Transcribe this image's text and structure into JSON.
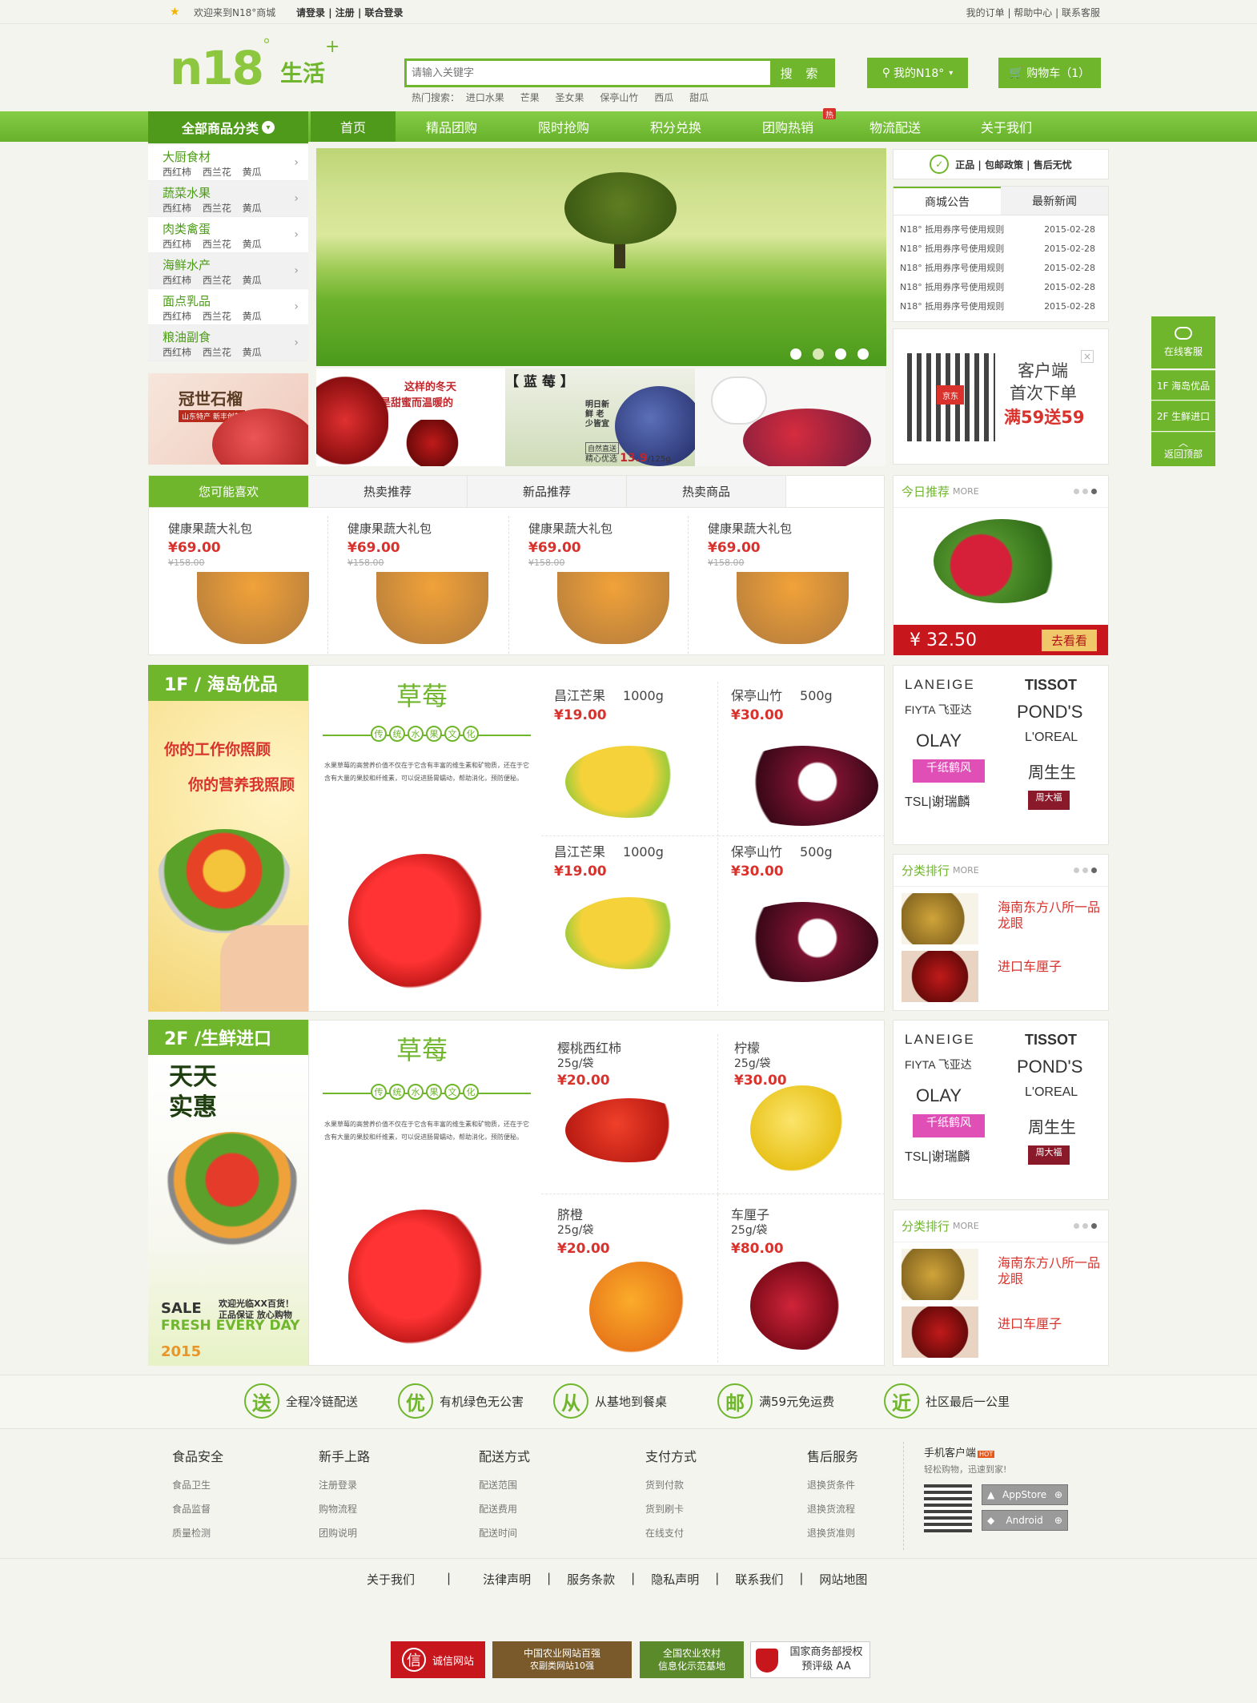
{
  "topbar": {
    "welcome": "欢迎来到N18°商城",
    "login": "请登录",
    "register": "注册",
    "union_login": "联合登录",
    "my_orders": "我的订单",
    "help": "帮助中心",
    "contact": "联系客服"
  },
  "logo": {
    "brand": "n18",
    "sup": "°",
    "life": "生活",
    "plus": "+"
  },
  "search": {
    "placeholder": "请输入关键字",
    "button": "搜 索",
    "hot_label": "热门搜索：",
    "hot": [
      "进口水果",
      "芒果",
      "圣女果",
      "保亭山竹",
      "西瓜",
      "甜瓜"
    ]
  },
  "header": {
    "my_n18": "我的N18°",
    "cart": "购物车（1）"
  },
  "nav": {
    "all_categories": "全部商品分类",
    "items": [
      "首页",
      "精品团购",
      "限时抢购",
      "积分兑换",
      "团购热销",
      "物流配送",
      "关于我们"
    ],
    "hot_badge": "热"
  },
  "categories": [
    {
      "title": "大厨食材",
      "subs": "西红柿 西兰花 黄瓜"
    },
    {
      "title": "蔬菜水果",
      "subs": "西红柿 西兰花 黄瓜"
    },
    {
      "title": "肉类禽蛋",
      "subs": "西红柿 西兰花 黄瓜"
    },
    {
      "title": "海鲜水产",
      "subs": "西红柿 西兰花 黄瓜"
    },
    {
      "title": "面点乳品",
      "subs": "西红柿 西兰花 黄瓜"
    },
    {
      "title": "粮油副食",
      "subs": "西红柿 西兰花 黄瓜"
    }
  ],
  "promo_ad": {
    "title": "冠世石榴",
    "sub": "山东特产  新丰创新"
  },
  "sub_banners": [
    {
      "line1": "这样的冬天",
      "line2": "是甜蜜而温暖的"
    },
    {
      "title": "【 蓝 莓 】",
      "side": "明日新鲜 老少皆宜",
      "price_label": "精心优选",
      "price": "13.9",
      "unit": "/125g",
      "tag": "自然直送"
    },
    {
      "caption": ""
    }
  ],
  "guarantee": "正品 | 包邮政策 | 售后无忧",
  "news": {
    "tabs": [
      "商城公告",
      "最新新闻"
    ],
    "items": [
      {
        "title": "N18° 抵用券序号使用规则",
        "date": "2015-02-28"
      },
      {
        "title": "N18° 抵用券序号使用规则",
        "date": "2015-02-28"
      },
      {
        "title": "N18° 抵用券序号使用规则",
        "date": "2015-02-28"
      },
      {
        "title": "N18° 抵用券序号使用规则",
        "date": "2015-02-28"
      },
      {
        "title": "N18° 抵用券序号使用规则",
        "date": "2015-02-28"
      }
    ]
  },
  "qr_promo": {
    "line1": "客户端",
    "line2": "首次下单",
    "line3": "满59送59",
    "close": "×",
    "badge": "京东"
  },
  "rec_tabs": [
    "您可能喜欢",
    "热卖推荐",
    "新品推荐",
    "热卖商品"
  ],
  "rec_products": [
    {
      "name": "健康果蔬大礼包",
      "price": "¥69.00",
      "old": "¥158.00"
    },
    {
      "name": "健康果蔬大礼包",
      "price": "¥69.00",
      "old": "¥158.00"
    },
    {
      "name": "健康果蔬大礼包",
      "price": "¥69.00",
      "old": "¥158.00"
    },
    {
      "name": "健康果蔬大礼包",
      "price": "¥69.00",
      "old": "¥158.00"
    }
  ],
  "today": {
    "title": "今日推荐",
    "more": "MORE",
    "price": "¥ 32.50",
    "button": "去看看"
  },
  "floor1": {
    "title": "1F / 海岛优品",
    "ad_line1": "你的工作你照顾",
    "ad_line2": "你的营养我照顾",
    "feature_title": "草莓",
    "feature_tags": [
      "传",
      "统",
      "水",
      "果",
      "文",
      "化"
    ],
    "feature_text": "水果草莓的高营养价值不仅在于它含有丰富的维生素和矿物质，还在于它含有大量的果胶和纤维素，可以促进肠胃蠕动，帮助消化，预防便秘。",
    "products": [
      {
        "name": "昌江芒果",
        "spec": "1000g",
        "price": "¥19.00"
      },
      {
        "name": "保亭山竹",
        "spec": "500g",
        "price": "¥30.00"
      },
      {
        "name": "昌江芒果",
        "spec": "1000g",
        "price": "¥19.00"
      },
      {
        "name": "保亭山竹",
        "spec": "500g",
        "price": "¥30.00"
      }
    ]
  },
  "floor2": {
    "title": "2F /生鲜进口",
    "ad_top1": "天天",
    "ad_top2": "实惠",
    "ad_sale": "SALE",
    "ad_welcome": "欢迎光临XX百货！",
    "ad_guarantee": "正品保证 放心购物",
    "ad_fresh": "FRESH EVERY DAY",
    "ad_year": "2015",
    "feature_title": "草莓",
    "feature_tags": [
      "传",
      "统",
      "水",
      "果",
      "文",
      "化"
    ],
    "feature_text": "水果草莓的高营养价值不仅在于它含有丰富的维生素和矿物质，还在于它含有大量的果胶和纤维素，可以促进肠胃蠕动，帮助消化，预防便秘。",
    "products": [
      {
        "name": "樱桃西红柿",
        "spec": "25g/袋",
        "price": "¥20.00"
      },
      {
        "name": "柠檬",
        "spec": "25g/袋",
        "price": "¥30.00"
      },
      {
        "name": "脐橙",
        "spec": "25g/袋",
        "price": "¥20.00"
      },
      {
        "name": "车厘子",
        "spec": "25g/袋",
        "price": "¥80.00"
      }
    ]
  },
  "brands": [
    "LANEIGE",
    "TISSOT",
    "FIYTA 飞亚达",
    "POND'S",
    "OLAY",
    "L'OREAL",
    "千纸鹤风",
    "周生生",
    "TSL|谢瑞麟",
    "周大福"
  ],
  "rank": {
    "title": "分类排行",
    "more": "MORE",
    "items": [
      "海南东方八所一品龙眼",
      "进口车厘子"
    ]
  },
  "services": [
    {
      "icon": "送",
      "text": "全程冷链配送"
    },
    {
      "icon": "优",
      "text": "有机绿色无公害"
    },
    {
      "icon": "从",
      "text": "从基地到餐桌"
    },
    {
      "icon": "邮",
      "text": "满59元免运费"
    },
    {
      "icon": "近",
      "text": "社区最后一公里"
    }
  ],
  "footer_cols": [
    {
      "title": "食品安全",
      "links": [
        "食品卫生",
        "食品监督",
        "质量检测"
      ]
    },
    {
      "title": "新手上路",
      "links": [
        "注册登录",
        "购物流程",
        "团购说明"
      ]
    },
    {
      "title": "配送方式",
      "links": [
        "配送范围",
        "配送费用",
        "配送时间"
      ]
    },
    {
      "title": "支付方式",
      "links": [
        "货到付款",
        "货到刷卡",
        "在线支付"
      ]
    },
    {
      "title": "售后服务",
      "links": [
        "退换货条件",
        "退换货流程",
        "退换货准则"
      ]
    }
  ],
  "mobile": {
    "title": "手机客户端",
    "hot": "HOT",
    "slogan": "轻松购物，迅速到家!",
    "appstore": "AppStore",
    "android": "Android"
  },
  "footer_links": [
    "关于我们",
    "法律声明",
    "服务条款",
    "隐私声明",
    "联系我们",
    "网站地图"
  ],
  "certs": [
    {
      "icon": "信",
      "text": "诚信网站"
    },
    {
      "text": "中国农业网站百强",
      "sub": "农副类网站10强"
    },
    {
      "text": "全国农业农村",
      "sub": "信息化示范基地"
    },
    {
      "text": "国家商务部授权",
      "sub": "预评级   AA"
    }
  ],
  "sidebar": {
    "service": "在线客服",
    "f1": "1F  海岛优品",
    "f2": "2F  生鲜进口",
    "top": "返回顶部"
  },
  "colors": {
    "brand_green": "#6fb62c",
    "dark_green": "#4f9a1b",
    "price_red": "#d9312b"
  }
}
